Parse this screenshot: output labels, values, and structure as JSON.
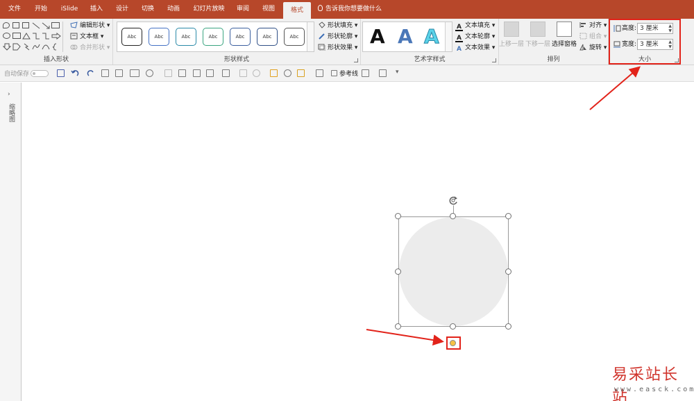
{
  "tabs": [
    {
      "label": "文件"
    },
    {
      "label": "开始"
    },
    {
      "label": "iSlide"
    },
    {
      "label": "插入"
    },
    {
      "label": "设计"
    },
    {
      "label": "切换"
    },
    {
      "label": "动画"
    },
    {
      "label": "幻灯片放映"
    },
    {
      "label": "审阅"
    },
    {
      "label": "视图"
    },
    {
      "label": "格式"
    }
  ],
  "tell_me": "告诉我你想要做什么",
  "ribbon": {
    "insert_shapes": {
      "label": "插入形状",
      "edit_shape": "编辑形状",
      "text_box": "文本框",
      "merge_shapes": "合并形状"
    },
    "shape_styles": {
      "label": "形状样式",
      "sample": "Abc",
      "fill": "形状填充",
      "outline": "形状轮廓",
      "effects": "形状效果"
    },
    "wordart": {
      "label": "艺术字样式",
      "letter": "A",
      "text_fill": "文本填充",
      "text_outline": "文本轮廓",
      "text_effects": "文本效果"
    },
    "arrange": {
      "label": "排列",
      "bring_forward": "上移一层",
      "send_backward": "下移一层",
      "selection_pane": "选择窗格",
      "align": "对齐",
      "group": "组合",
      "rotate": "旋转"
    },
    "size": {
      "label": "大小",
      "height_label": "高度:",
      "height_value": "3 厘米",
      "width_label": "宽度:",
      "width_value": "3 厘米"
    }
  },
  "qat": {
    "autosave": "自动保存",
    "guides": "参考线"
  },
  "left_pane": {
    "label": "缩略图"
  },
  "watermark": {
    "text": "易采站长站",
    "url": "www.easck.com"
  },
  "colors": {
    "accent": "#b7472a",
    "annotation": "#e2231a",
    "shape_fill": "#ececec",
    "adjust_handle": "#f6c244"
  }
}
